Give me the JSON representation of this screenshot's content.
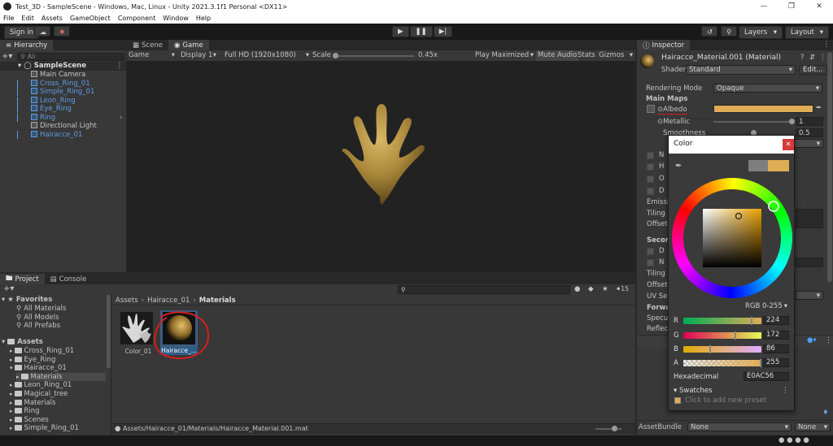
{
  "window": {
    "title": "Test_3D - SampleScene - Windows, Mac, Linux - Unity 2021.3.1f1 Personal <DX11>"
  },
  "menu": [
    "File",
    "Edit",
    "Assets",
    "GameObject",
    "Component",
    "Window",
    "Help"
  ],
  "toolbar": {
    "sign_in": "Sign in",
    "layers": "Layers",
    "layout": "Layout"
  },
  "hierarchy": {
    "tab": "Hierarchy",
    "search_placeholder": "All",
    "scene": "SampleScene",
    "items": [
      {
        "label": "Main Camera",
        "prefab": false
      },
      {
        "label": "Cross_Ring_01",
        "prefab": true
      },
      {
        "label": "Simple_Ring_01",
        "prefab": true
      },
      {
        "label": "Leon_Ring",
        "prefab": true
      },
      {
        "label": "Eye_Ring",
        "prefab": true
      },
      {
        "label": "Ring",
        "prefab": true
      },
      {
        "label": "Directional Light",
        "prefab": false
      },
      {
        "label": "Hairacce_01",
        "prefab": true
      }
    ]
  },
  "game": {
    "tab_scene": "Scene",
    "tab_game": "Game",
    "game_dropdown": "Game",
    "display": "Display 1",
    "resolution": "Full HD (1920x1080)",
    "scale_label": "Scale",
    "scale_value": "0.45x",
    "play_maximized": "Play Maximized",
    "mute_audio": "Mute Audio",
    "stats": "Stats",
    "gizmos": "Gizmos",
    "viewport_color": "#6e5f5a",
    "object_color": "#E0AC56"
  },
  "project": {
    "tab_project": "Project",
    "tab_console": "Console",
    "favorites": "Favorites",
    "fav_items": [
      "All Materials",
      "All Models",
      "All Prefabs"
    ],
    "assets": "Assets",
    "asset_items": [
      {
        "label": "Cross_Ring_01",
        "indent": 1
      },
      {
        "label": "Eye_Ring",
        "indent": 1
      },
      {
        "label": "Hairacce_01",
        "indent": 1
      },
      {
        "label": "Materials",
        "indent": 2
      },
      {
        "label": "Leon_Ring_01",
        "indent": 1
      },
      {
        "label": "Magical_tree",
        "indent": 1
      },
      {
        "label": "Materials",
        "indent": 1
      },
      {
        "label": "Ring",
        "indent": 1
      },
      {
        "label": "Scenes",
        "indent": 1
      },
      {
        "label": "Simple_Ring_01",
        "indent": 1
      }
    ],
    "breadcrumb": [
      "Assets",
      "Hairacce_01",
      "Materials"
    ],
    "hidden_count": "15",
    "thumbs": [
      {
        "label": "Color_01"
      },
      {
        "label": "Hairacce_..."
      }
    ],
    "status_path": "Assets/Hairacce_01/Materials/Hairacce_Material.001.mat"
  },
  "inspector": {
    "tab": "Inspector",
    "material_name": "Hairacce_Material.001 (Material)",
    "shader_label": "Shader",
    "shader_value": "Standard",
    "edit_button": "Edit...",
    "rendering_mode_label": "Rendering Mode",
    "rendering_mode_value": "Opaque",
    "main_maps": "Main Maps",
    "albedo": "Albedo",
    "albedo_color": "#E0AC56",
    "metallic_label": "Metallic",
    "metallic_value": "1",
    "smoothness_label": "Smoothness",
    "smoothness_value": "0.5",
    "side_labels": [
      "Emissi",
      "Tiling",
      "Offset",
      "Second",
      "Tiling",
      "Offset",
      "UV Set",
      "Forwar",
      "Specul",
      "Reflect",
      "Hairacc"
    ],
    "small_letters": [
      "N",
      "H",
      "O",
      "D",
      "D",
      "N"
    ],
    "asset_bundle_label": "AssetBundle",
    "asset_bundle_value": "None",
    "asset_bundle_variant": "None"
  },
  "color_picker": {
    "title": "Color",
    "mode": "RGB 0-255",
    "channels": [
      {
        "name": "R",
        "value": "224"
      },
      {
        "name": "G",
        "value": "172"
      },
      {
        "name": "B",
        "value": "86"
      },
      {
        "name": "A",
        "value": "255"
      }
    ],
    "hex_label": "Hexadecimal",
    "hex_value": "E0AC56",
    "swatches_label": "Swatches",
    "swatches_hint": "Click to add new preset",
    "previous_color": "#7f7f7f",
    "current_color": "#E0AC56"
  }
}
